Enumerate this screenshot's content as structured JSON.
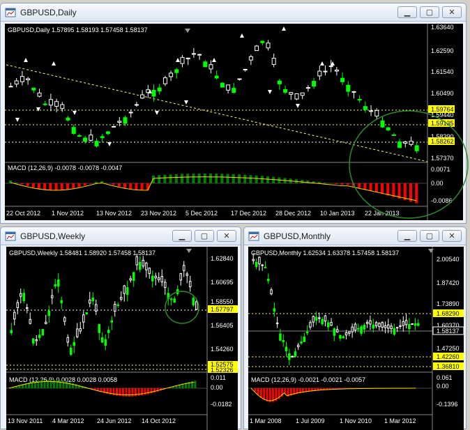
{
  "colors": {
    "bull": "#00ff00",
    "bear": "#ffffff",
    "macd_pos": "#008000",
    "macd_neg": "#ff0000",
    "signal": "#ffd700",
    "trend": "#ffff66",
    "circle": "#2e8b2e",
    "highlight": "#ffff00"
  },
  "windows": {
    "daily": {
      "title": "GBPUSD,Daily",
      "header": "GBPUSD,Daily  1.57895 1.58193 1.57458 1.58137",
      "macd_label": "MACD (12,26,9) -0.0078 -0.0078 -0.0047",
      "price_axis": [
        "1.63640",
        "1.62590",
        "1.61540",
        "1.60490",
        "1.59440",
        "1.58390",
        "1.57370"
      ],
      "hlines": [
        "1.59764",
        "1.59135",
        "1.58262"
      ],
      "macd_axis": [
        "0.0071",
        "0.00",
        "-0.0086"
      ],
      "x_axis": [
        "22 Oct 2012",
        "1 Nov 2012",
        "13 Nov 2012",
        "23 Nov 2012",
        "5 Dec 2012",
        "17 Dec 2012",
        "28 Dec 2012",
        "10 Jan 2013",
        "22 Jan 2013"
      ]
    },
    "weekly": {
      "title": "GBPUSD,Weekly",
      "header": "GBPUSD,Weekly  1.58481 1.58920 1.57458 1.58137",
      "macd_label": "MACD (12,26,9) 0.0028 0.0028 0.0058",
      "price_axis": [
        "1.62840",
        "1.60695",
        "1.58550",
        "1.56405",
        "1.54260"
      ],
      "hlines": [
        "1.57797",
        "1.52575",
        "1.52326"
      ],
      "macd_axis": [
        "0.011",
        "0.00",
        "-0.0182"
      ],
      "x_axis": [
        "13 Nov 2011",
        "4 Mar 2012",
        "24 Jun 2012",
        "14 Oct 2012"
      ]
    },
    "monthly": {
      "title": "GBPUSD,Monthly",
      "header": "GBPUSD,Monthly  1.62534 1.63378 1.57458 1.58137",
      "macd_label": "MACD (12,26,9) -0.0021 -0.0021 -0.0057",
      "price_axis": [
        "2.00540",
        "1.87420",
        "1.73890",
        "1.60370",
        "1.47250"
      ],
      "hlines": [
        "1.68290",
        "1.58137",
        "1.42260",
        "1.36810"
      ],
      "macd_axis": [
        "0.061",
        "0.00",
        "-0.1396"
      ],
      "x_axis": [
        "1 Mar 2008",
        "1 Jul 2009",
        "1 Nov 2010",
        "1 Mar 2012"
      ]
    }
  },
  "icons": {
    "window": "chart-window-icon",
    "minimize": "minimize-icon",
    "restore": "restore-icon",
    "close": "close-icon"
  }
}
